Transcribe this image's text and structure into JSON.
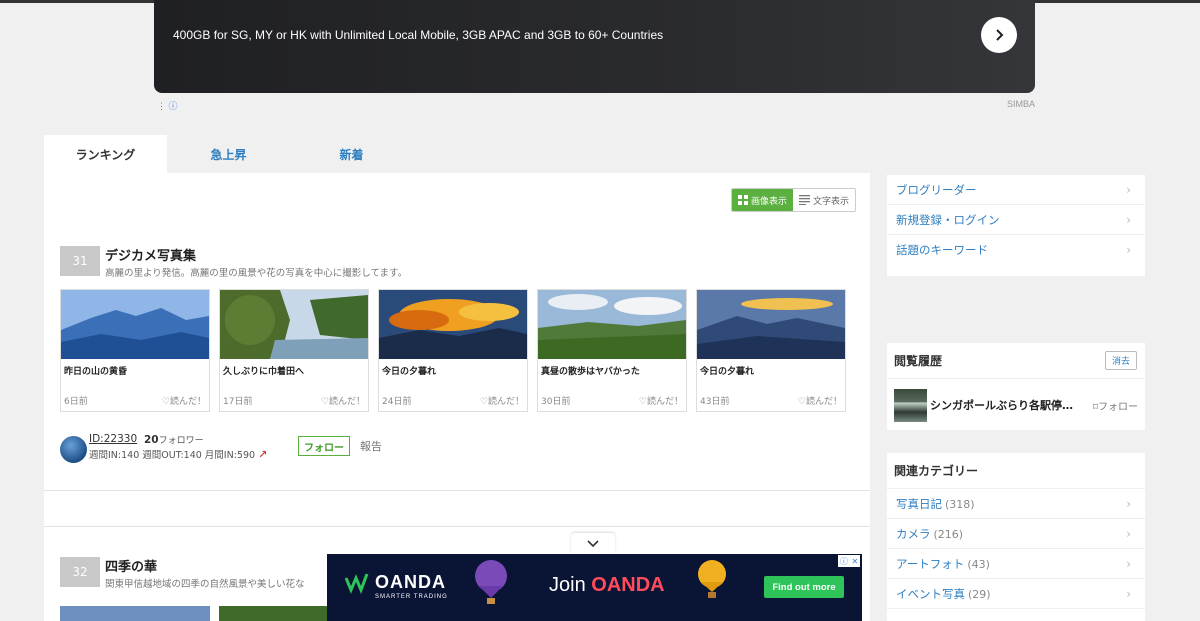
{
  "top_ad": {
    "text": "400GB for SG, MY or HK with Unlimited Local Mobile, 3GB APAC and 3GB to 60+ Countries",
    "advertiser": "SIMBA",
    "menu_dots": "⋮",
    "info_symbol": "ⓘ"
  },
  "tabs": [
    {
      "label": "ランキング"
    },
    {
      "label": "急上昇"
    },
    {
      "label": "新着"
    }
  ],
  "view_toggle": {
    "image_view": "画像表示",
    "text_view": "文字表示"
  },
  "entries": [
    {
      "rank": "31",
      "title": "デジカメ写真集",
      "description": "高麗の里より発信。高麗の里の風景や花の写真を中心に撮影してます。",
      "cards": [
        {
          "title": "昨日の山の黄昏",
          "date": "6日前",
          "read": "読んだ！"
        },
        {
          "title": "久しぶりに巾着田へ",
          "date": "17日前",
          "read": "読んだ！"
        },
        {
          "title": "今日の夕暮れ",
          "date": "24日前",
          "read": "読んだ！"
        },
        {
          "title": "真昼の散歩はヤバかった",
          "date": "30日前",
          "read": "読んだ！"
        },
        {
          "title": "今日の夕暮れ",
          "date": "43日前",
          "read": "読んだ！"
        }
      ],
      "user_id": "ID:22330",
      "followers_num": "20",
      "followers_label": "フォロワー",
      "stats": "週間IN:140  週間OUT:140  月間IN:590",
      "follow_label": "フォロー",
      "report_label": "報告"
    },
    {
      "rank": "32",
      "title": "四季の華",
      "description": "関東甲信越地域の四季の自然風景や美しい花な"
    }
  ],
  "sidebar": {
    "links": [
      {
        "label": "ブログリーダー"
      },
      {
        "label": "新規登録・ログイン"
      },
      {
        "label": "話題のキーワード"
      }
    ],
    "history": {
      "heading": "閲覧履歴",
      "clear_label": "消去",
      "item_title": "シンガポールぶらり各駅停…",
      "item_follow": "フォロー"
    },
    "categories": {
      "heading": "関連カテゴリー",
      "items": [
        {
          "label": "写真日記",
          "count": "(318)"
        },
        {
          "label": "カメラ",
          "count": "(216)"
        },
        {
          "label": "アートフォト",
          "count": "(43)"
        },
        {
          "label": "イベント写真",
          "count": "(29)"
        }
      ]
    }
  },
  "bottom_ad": {
    "brand": "OANDA",
    "tagline": "SMARTER TRADING",
    "join_text": "Join",
    "join_brand": "OANDA",
    "cta": "Find out more"
  },
  "colors": {
    "accent_blue": "#2f7fc1",
    "follow_green": "#5cb040",
    "ad_navy": "#0a1435",
    "oanda_red": "#ff4b5c"
  }
}
